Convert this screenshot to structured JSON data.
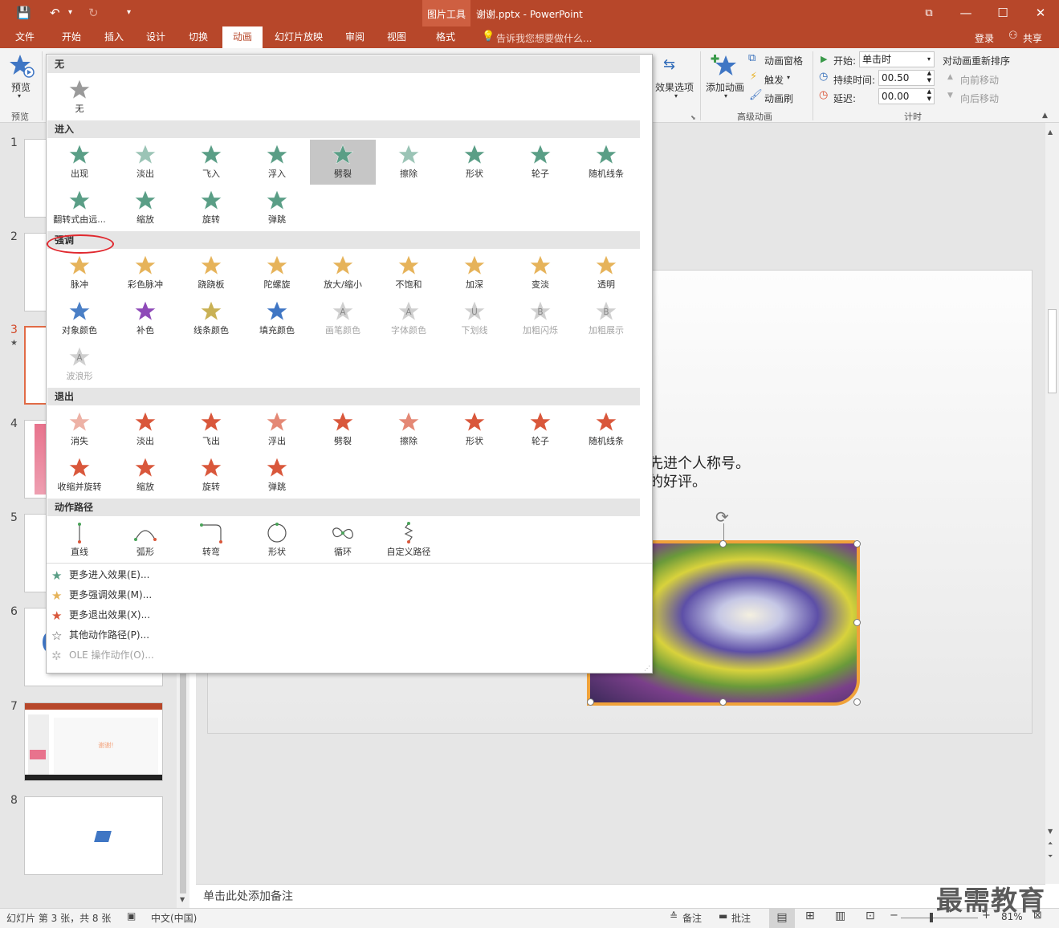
{
  "titlebar": {
    "context_tab": "图片工具",
    "title": "谢谢.pptx - PowerPoint"
  },
  "qat": {
    "save": "💾",
    "undo": "↶",
    "redo": "↻",
    "more": "▾"
  },
  "window": {
    "restore": "⧉",
    "minimize": "—",
    "maximize": "☐",
    "close": "✕"
  },
  "tabs": [
    "文件",
    "开始",
    "插入",
    "设计",
    "切换",
    "动画",
    "幻灯片放映",
    "审阅",
    "视图",
    "格式"
  ],
  "tell_me": "告诉我您想要做什么...",
  "account": {
    "login": "登录",
    "share": "共享"
  },
  "ribbon": {
    "preview_label": "预览",
    "preview_group": "预览",
    "effect_options": "效果选项",
    "add_animation": "添加动画",
    "anim_pane": "动画窗格",
    "trigger": "触发",
    "anim_painter": "动画刷",
    "advanced_group": "高级动画",
    "start_label": "开始:",
    "start_value": "单击时",
    "duration_label": "持续时间:",
    "duration_value": "00.50",
    "delay_label": "延迟:",
    "delay_value": "00.00",
    "timing_group": "计时",
    "reorder": "对动画重新排序",
    "move_earlier": "向前移动",
    "move_later": "向后移动"
  },
  "colors": {
    "accent": "#b7472a",
    "entrance": "#5a9e86",
    "emphasis": "#e6b35a",
    "exit": "#d9573b",
    "highlight_circle": "#e0282e"
  },
  "gallery": {
    "sections": {
      "none": "无",
      "entrance": "进入",
      "emphasis": "强调",
      "exit": "退出",
      "paths": "动作路径"
    },
    "none_item": "无",
    "entrance": [
      "出现",
      "淡出",
      "飞入",
      "浮入",
      "劈裂",
      "擦除",
      "形状",
      "轮子",
      "随机线条",
      "翻转式由远...",
      "缩放",
      "旋转",
      "弹跳"
    ],
    "emphasis": [
      "脉冲",
      "彩色脉冲",
      "跷跷板",
      "陀螺旋",
      "放大/缩小",
      "不饱和",
      "加深",
      "变淡",
      "透明",
      "对象颜色",
      "补色",
      "线条颜色",
      "填充颜色",
      "画笔颜色",
      "字体颜色",
      "下划线",
      "加粗闪烁",
      "加粗展示",
      "波浪形"
    ],
    "emphasis_glyphs": {
      "画笔颜色": "A",
      "字体颜色": "A",
      "下划线": "U",
      "加粗闪烁": "B",
      "加粗展示": "B",
      "波浪形": "A"
    },
    "exit": [
      "消失",
      "淡出",
      "飞出",
      "浮出",
      "劈裂",
      "擦除",
      "形状",
      "轮子",
      "随机线条",
      "收缩并旋转",
      "缩放",
      "旋转",
      "弹跳"
    ],
    "paths": [
      "直线",
      "弧形",
      "转弯",
      "形状",
      "循环",
      "自定义路径"
    ],
    "more": [
      "更多进入效果(E)...",
      "更多强调效果(M)...",
      "更多退出效果(X)...",
      "其他动作路径(P)...",
      "OLE 操作动作(O)..."
    ]
  },
  "slide_numbers": [
    "1",
    "2",
    "3",
    "4",
    "5",
    "6",
    "7",
    "8"
  ],
  "thumb7_text": "谢谢!",
  "slide_text": {
    "line1": "先进个人称号。",
    "line2": "的好评。"
  },
  "notes_placeholder": "单击此处添加备注",
  "status": {
    "slide_info": "幻灯片 第 3 张，共 8 张",
    "language": "中文(中国)",
    "notes": "备注",
    "comments": "批注",
    "zoom": "81%"
  },
  "watermark": "最需教育"
}
